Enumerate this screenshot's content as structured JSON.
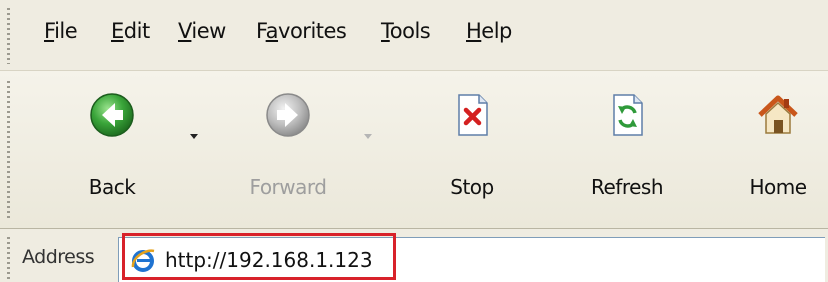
{
  "menubar": {
    "items": [
      {
        "label": "File",
        "accel": "F",
        "rest": "ile"
      },
      {
        "label": "Edit",
        "accel": "E",
        "rest": "dit"
      },
      {
        "label": "View",
        "accel": "V",
        "rest": "iew"
      },
      {
        "label": "Favorites",
        "pre": "F",
        "accel": "a",
        "rest": "vorites"
      },
      {
        "label": "Tools",
        "accel": "T",
        "rest": "ools"
      },
      {
        "label": "Help",
        "accel": "H",
        "rest": "elp"
      }
    ]
  },
  "toolbar": {
    "buttons": [
      {
        "label": "Back",
        "icon": "back-arrow-icon",
        "enabled": true,
        "has_dropdown": true
      },
      {
        "label": "Forward",
        "icon": "forward-arrow-icon",
        "enabled": false,
        "has_dropdown": true
      },
      {
        "label": "Stop",
        "icon": "stop-page-icon",
        "enabled": true,
        "has_dropdown": false
      },
      {
        "label": "Refresh",
        "icon": "refresh-page-icon",
        "enabled": true,
        "has_dropdown": false
      },
      {
        "label": "Home",
        "icon": "home-icon",
        "enabled": true,
        "has_dropdown": false
      }
    ]
  },
  "addressbar": {
    "label": "Address",
    "url": "http://192.168.1.123",
    "icon": "ie-page-icon"
  },
  "colors": {
    "highlight": "#d8222a",
    "back_green": "#3aa53a",
    "stop_red": "#d42020",
    "refresh_green": "#2f9a3a"
  }
}
